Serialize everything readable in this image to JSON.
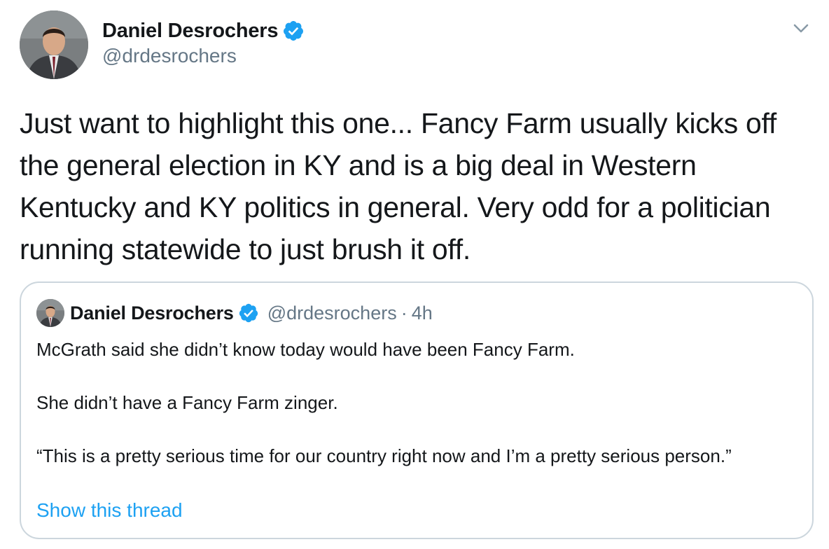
{
  "tweet": {
    "author": {
      "name": "Daniel Desrochers",
      "handle": "@drdesrochers",
      "verified": true,
      "avatar_icon": "profile-photo"
    },
    "text": "Just want to highlight this one... Fancy Farm usually kicks off the general election in KY and is a big deal in Western Kentucky and KY politics in general. Very odd for a politician running statewide to just brush it off.",
    "menu_icon": "chevron-down-icon"
  },
  "quoted_tweet": {
    "author": {
      "name": "Daniel Desrochers",
      "handle": "@drdesrochers",
      "verified": true
    },
    "separator": "·",
    "time": "4h",
    "paragraphs": [
      "McGrath said she didn’t know today would have been Fancy Farm.",
      "She didn’t have a Fancy Farm zinger.",
      "“This is a pretty serious time for our country right now and I’m a pretty serious person.”"
    ],
    "show_thread_label": "Show this thread"
  },
  "colors": {
    "text_primary": "#14171a",
    "text_secondary": "#657786",
    "link": "#1da1f2",
    "verified": "#1da1f2",
    "border": "#ccd6dd"
  }
}
